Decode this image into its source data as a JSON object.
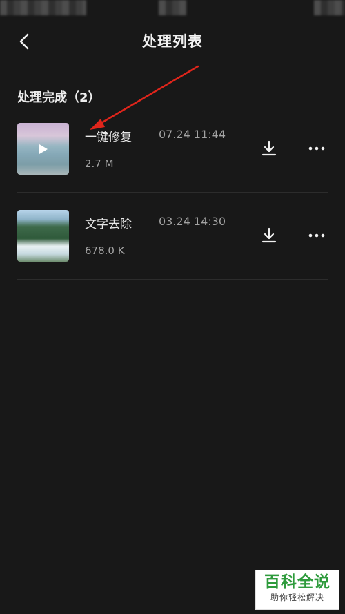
{
  "header": {
    "title": "处理列表"
  },
  "section": {
    "title": "处理完成（2）"
  },
  "items": [
    {
      "name": "一键修复",
      "date": "07.24 11:44",
      "size": "2.7 M"
    },
    {
      "name": "文字去除",
      "date": "03.24 14:30",
      "size": "678.0 K"
    }
  ],
  "icons": {
    "back": "chevron-left-icon",
    "download": "download-icon",
    "more": "more-icon",
    "play": "play-icon"
  },
  "colors": {
    "background": "#181818",
    "annotation_arrow": "#e0251b",
    "watermark_green": "#2e9b3c"
  },
  "watermark": {
    "main": "百科全说",
    "sub": "助你轻松解决"
  }
}
